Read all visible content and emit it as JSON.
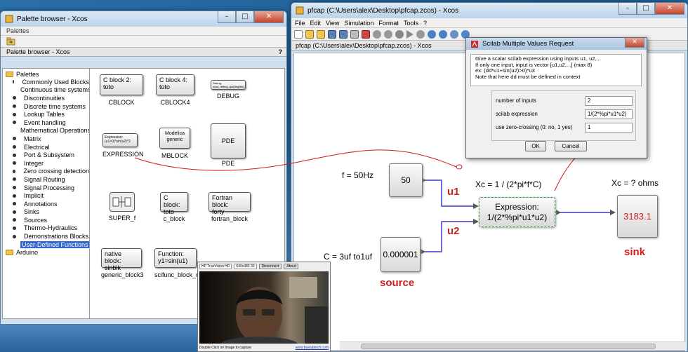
{
  "palette_window": {
    "title": "Palette browser - Xcos",
    "menu_label": "Palettes",
    "panel_title": "Palette browser - Xcos",
    "help_mark": "?",
    "tree": {
      "root_label": "Palettes",
      "items": [
        "Commonly Used Blocks",
        "Continuous time systems",
        "Discontinuities",
        "Discrete time systems",
        "Lookup Tables",
        "Event handling",
        "Mathematical Operations",
        "Matrix",
        "Electrical",
        "Port & Subsystem",
        "Integer",
        "Zero crossing detection",
        "Signal Routing",
        "Signal Processing",
        "Implicit",
        "Annotations",
        "Sinks",
        "Sources",
        "Thermo-Hydraulics",
        "Demonstrations Blocks",
        "User-Defined Functions"
      ],
      "selected": "User-Defined Functions",
      "extra_root": "Arduino"
    },
    "blocks": {
      "cblock": {
        "box": "C block 2:\ntoto",
        "caption": "CBLOCK"
      },
      "cblock4": {
        "box": "C block 4:\ntoto",
        "caption": "CBLOCK4"
      },
      "debug": {
        "box": "Debug:\nxcos_debug_gui(flag,blk);",
        "caption": "DEBUG"
      },
      "expression": {
        "box": "Expression:\n(u1>0)*sin(u2)^2",
        "caption": "EXPRESSION"
      },
      "mblock": {
        "box": "Modelica\ngeneric",
        "caption": "MBLOCK"
      },
      "pde": {
        "box": "PDE",
        "caption": "PDE"
      },
      "super_f": {
        "caption": "SUPER_f"
      },
      "c_block": {
        "box": "C block:\ntoto",
        "caption": "c_block"
      },
      "fortran_block": {
        "box": "Fortran block:\nforty",
        "caption": "fortran_block"
      },
      "generic_block3": {
        "box": "native block:\nsinblk",
        "caption": "generic_block3"
      },
      "scifunc_block": {
        "box": "Function:\ny1=sin(u1)",
        "caption": "scifunc_block_m"
      }
    }
  },
  "xcos_window": {
    "title": "pfcap (C:\\Users\\alex\\Desktop\\pfcap.zcos) - Xcos",
    "menu": [
      "File",
      "Edit",
      "View",
      "Simulation",
      "Format",
      "Tools",
      "?"
    ],
    "tab_title": "pfcap (C:\\Users\\alex\\Desktop\\pfcap.zcos) - Xcos",
    "diagram": {
      "freq_label": "f = 50Hz",
      "const_value": "50",
      "u1_label": "u1",
      "u2_label": "u2",
      "xc_formula": "Xc = 1 / (2*pi*f*C)",
      "expr_text_1": "Expression:",
      "expr_text_2": "1/(2*%pi*u1*u2)",
      "xc_result_label": "Xc = ? ohms",
      "sink_value": "3183.1",
      "sink_label": "sink",
      "cap_label": "C = 3uf to1uf",
      "source_value": "0.000001",
      "source_label": "source"
    }
  },
  "dialog": {
    "title": "Scilab Multiple Values Request",
    "description": [
      "Give a scalar scilab expression using inputs u1, u2,...",
      "If only one input, input is vector [u1,u2,...] (max 8)",
      "ex: (dd*u1+sin(u2)>0)*u3",
      "Note that here dd must be defined in context"
    ],
    "fields": [
      {
        "label": "number of inputs",
        "value": "2"
      },
      {
        "label": "scilab expression",
        "value": "1/(2*%pi*u1*u2)"
      },
      {
        "label": "use zero-crossing (0: no, 1 yes)",
        "value": "1"
      }
    ],
    "ok_label": "OK",
    "cancel_label": "Cancel"
  },
  "webcam": {
    "device": "HP TrueVision HD",
    "resolution": "640x480 30",
    "disconnect_label": "Disconnect",
    "about_label": "About",
    "hint": "Double Click on Image to capture",
    "link": "www.buelabtech.com"
  },
  "colors": {
    "accent_red": "#cc1f1f",
    "link_blue": "#3344cc",
    "selection_green": "#3a9a3a"
  }
}
